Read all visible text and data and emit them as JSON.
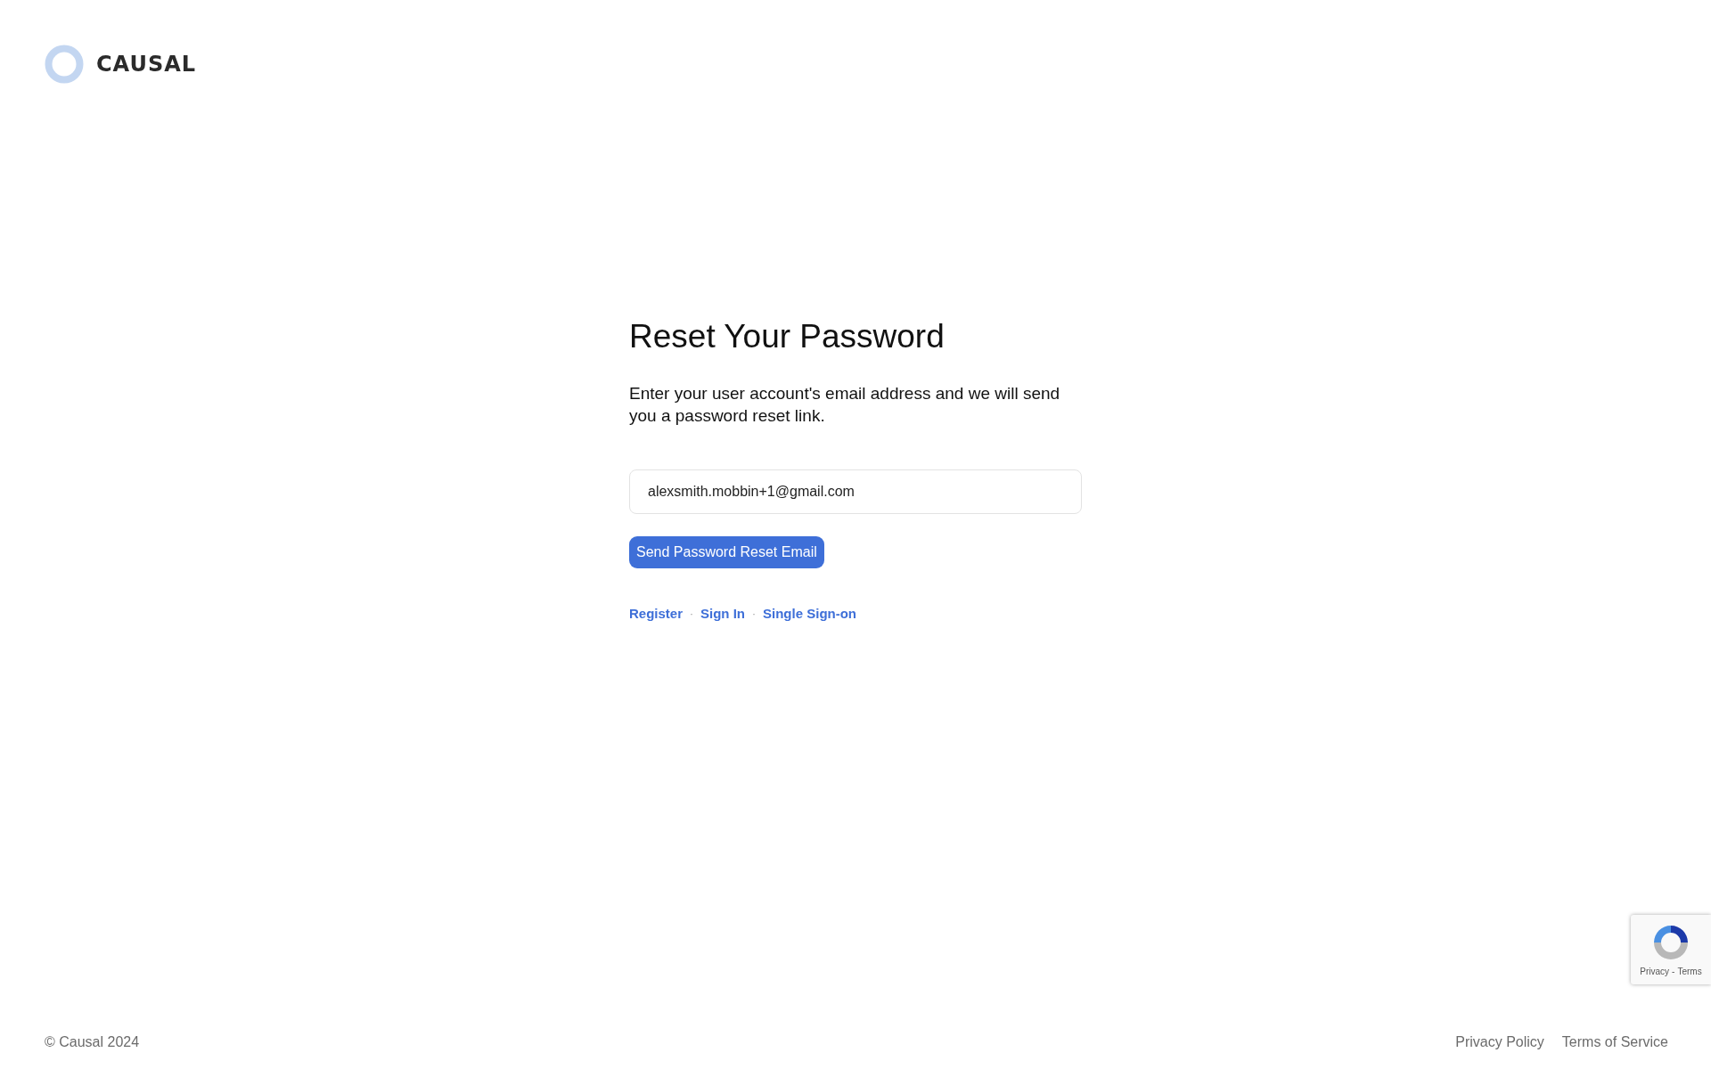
{
  "logo": {
    "text": "CAUSAL"
  },
  "form": {
    "title": "Reset Your Password",
    "description": "Enter your user account's email address and we will send you a password reset link.",
    "email": {
      "value": "alexsmith.mobbin+1@gmail.com"
    },
    "submit": "Send Password Reset Email"
  },
  "links": {
    "items": [
      "Register",
      "Sign In",
      "Single Sign-on"
    ],
    "separator": "·"
  },
  "footer": {
    "copyright": "© Causal 2024",
    "links": [
      "Privacy Policy",
      "Terms of Service"
    ]
  },
  "recaptcha": {
    "links": [
      "Privacy",
      "Terms"
    ],
    "separator": "-"
  }
}
